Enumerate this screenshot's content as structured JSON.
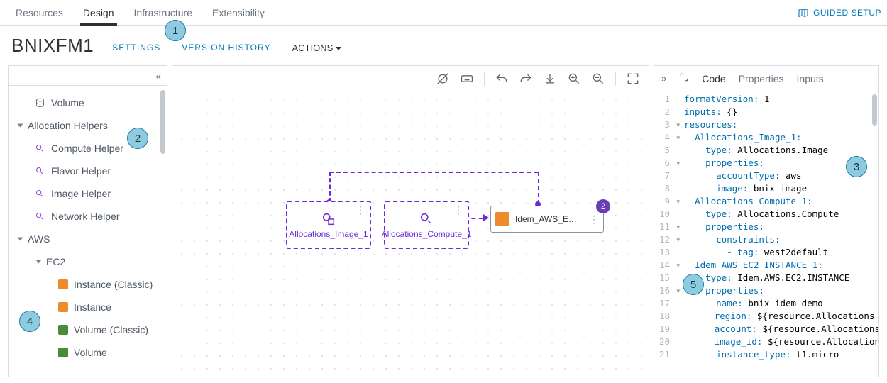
{
  "top_tabs": {
    "resources": "Resources",
    "design": "Design",
    "infrastructure": "Infrastructure",
    "extensibility": "Extensibility"
  },
  "guided_setup": "GUIDED SETUP",
  "title": "BNIXFM1",
  "subnav": {
    "settings": "SETTINGS",
    "version_history": "VERSION HISTORY",
    "actions": "ACTIONS"
  },
  "tree": {
    "volume": "Volume",
    "allocation_helpers": "Allocation Helpers",
    "compute_helper": "Compute Helper",
    "flavor_helper": "Flavor Helper",
    "image_helper": "Image Helper",
    "network_helper": "Network Helper",
    "aws": "AWS",
    "ec2": "EC2",
    "instance_classic": "Instance (Classic)",
    "instance": "Instance",
    "volume_classic": "Volume (Classic)",
    "volume2": "Volume"
  },
  "canvas": {
    "node_img": "Allocations_Image_1",
    "node_compute": "Allocations_Compute_1",
    "node_ec2": "Idem_AWS_E…",
    "badge": "2"
  },
  "right_tabs": {
    "code": "Code",
    "properties": "Properties",
    "inputs": "Inputs"
  },
  "code": {
    "l1a": "formatVersion: ",
    "l1b": "1",
    "l2a": "inputs: ",
    "l2b": "{}",
    "l3": "resources:",
    "l4": "Allocations_Image_1:",
    "l5a": "type: ",
    "l5b": "Allocations.Image",
    "l6": "properties:",
    "l7a": "accountType: ",
    "l7b": "aws",
    "l8a": "image: ",
    "l8b": "bnix-image",
    "l9": "Allocations_Compute_1:",
    "l10a": "type: ",
    "l10b": "Allocations.Compute",
    "l11": "properties:",
    "l12": "constraints:",
    "l13a": "- tag: ",
    "l13b": "west2default",
    "l14": "Idem_AWS_EC2_INSTANCE_1:",
    "l15a": "type: ",
    "l15b": "Idem.AWS.EC2.INSTANCE",
    "l16": "properties:",
    "l17a": "name: ",
    "l17b": "bnix-idem-demo",
    "l18a": "region: ",
    "l18b": "${resource.Allocations_Com",
    "l19a": "account: ",
    "l19b": "${resource.Allocations_Co",
    "l20a": "image_id: ",
    "l20b": "${resource.Allocations_I",
    "l21a": "instance_type: ",
    "l21b": "t1.micro"
  },
  "line_numbers": [
    "1",
    "2",
    "3",
    "4",
    "5",
    "6",
    "7",
    "8",
    "9",
    "10",
    "11",
    "12",
    "13",
    "14",
    "15",
    "16",
    "17",
    "18",
    "19",
    "20",
    "21"
  ],
  "callouts": {
    "c1": "1",
    "c2": "2",
    "c3": "3",
    "c4": "4",
    "c5": "5"
  }
}
